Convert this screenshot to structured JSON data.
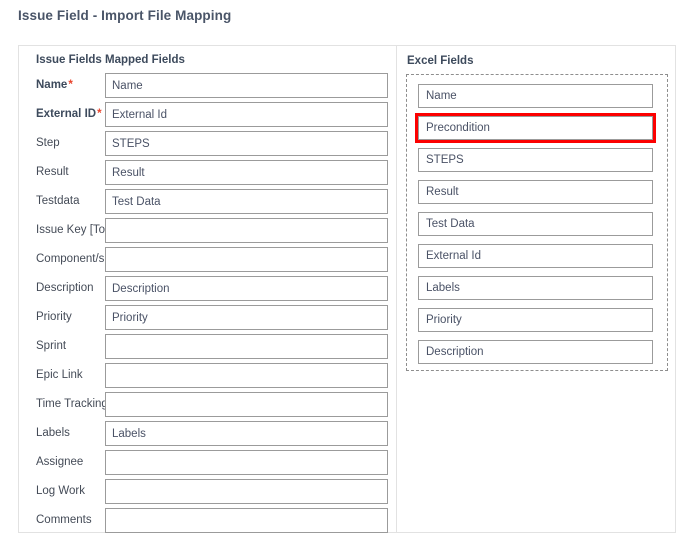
{
  "page": {
    "title": "Issue Field - Import File Mapping",
    "accent_color": "#4a5568",
    "required_marker_color": "#e8442c",
    "highlight_color": "#fc0000"
  },
  "issue_pane": {
    "column_headers": {
      "issue_fields": "Issue Fields",
      "mapped_fields": "Mapped Fields"
    },
    "rows": [
      {
        "label": "Name",
        "required": true,
        "required_marker": "*",
        "value": "Name",
        "placeholder": ""
      },
      {
        "label": "External ID",
        "required": true,
        "required_marker": "*",
        "value": "External Id",
        "placeholder": ""
      },
      {
        "label": "Step",
        "required": false,
        "required_marker": "",
        "value": "STEPS",
        "placeholder": ""
      },
      {
        "label": "Result",
        "required": false,
        "required_marker": "",
        "value": "Result",
        "placeholder": ""
      },
      {
        "label": "Testdata",
        "required": false,
        "required_marker": "",
        "value": "Test Data",
        "placeholder": ""
      },
      {
        "label": "Issue Key [To a…",
        "required": false,
        "required_marker": "",
        "value": "",
        "placeholder": ""
      },
      {
        "label": "Component/s",
        "required": false,
        "required_marker": "",
        "value": "",
        "placeholder": ""
      },
      {
        "label": "Description",
        "required": false,
        "required_marker": "",
        "value": "Description",
        "placeholder": ""
      },
      {
        "label": "Priority",
        "required": false,
        "required_marker": "",
        "value": "Priority",
        "placeholder": ""
      },
      {
        "label": "Sprint",
        "required": false,
        "required_marker": "",
        "value": "",
        "placeholder": ""
      },
      {
        "label": "Epic Link",
        "required": false,
        "required_marker": "",
        "value": "",
        "placeholder": ""
      },
      {
        "label": "Time Tracking",
        "required": false,
        "required_marker": "",
        "value": "",
        "placeholder": ""
      },
      {
        "label": "Labels",
        "required": false,
        "required_marker": "",
        "value": "Labels",
        "placeholder": ""
      },
      {
        "label": "Assignee",
        "required": false,
        "required_marker": "",
        "value": "",
        "placeholder": ""
      },
      {
        "label": "Log Work",
        "required": false,
        "required_marker": "",
        "value": "",
        "placeholder": ""
      },
      {
        "label": "Comments",
        "required": false,
        "required_marker": "",
        "value": "",
        "placeholder": ""
      }
    ]
  },
  "excel_pane": {
    "header": "Excel Fields",
    "items": [
      {
        "label": "Name",
        "highlighted": false
      },
      {
        "label": "Precondition",
        "highlighted": true
      },
      {
        "label": "STEPS",
        "highlighted": false
      },
      {
        "label": "Result",
        "highlighted": false
      },
      {
        "label": "Test Data",
        "highlighted": false
      },
      {
        "label": "External Id",
        "highlighted": false
      },
      {
        "label": "Labels",
        "highlighted": false
      },
      {
        "label": "Priority",
        "highlighted": false
      },
      {
        "label": "Description",
        "highlighted": false
      }
    ]
  }
}
